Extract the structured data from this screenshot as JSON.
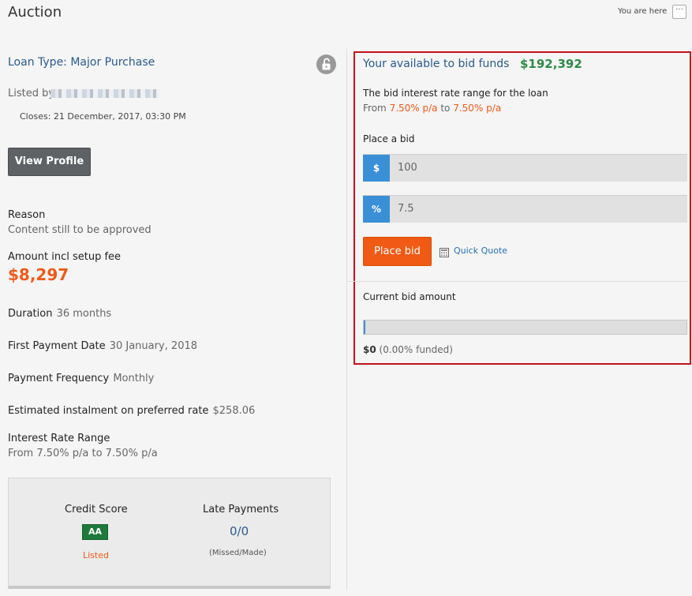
{
  "header": {
    "title": "Auction",
    "breadcrumb": "You are here",
    "more_label": "···"
  },
  "loan": {
    "type": "Loan Type: Major Purchase",
    "listed_by_label": "Listed by",
    "closes": "Closes: 21 December, 2017, 03:30 PM",
    "view_profile_label": "View Profile",
    "reason_label": "Reason",
    "reason_value": "Content still to be approved",
    "amount_label": "Amount incl setup fee",
    "amount_value": "$8,297",
    "duration_label": "Duration",
    "duration_value": "36 months",
    "first_payment_label": "First Payment Date",
    "first_payment_value": "30 January, 2018",
    "frequency_label": "Payment Frequency",
    "frequency_value": "Monthly",
    "instalment_label": "Estimated instalment on preferred rate",
    "instalment_value": "$258.06",
    "irr_label": "Interest Rate Range",
    "irr_value": "From 7.50% p/a to 7.50% p/a"
  },
  "credit": {
    "score_label": "Credit Score",
    "score_badge": "AA",
    "status": "Listed",
    "late_label": "Late Payments",
    "late_value": "0/0",
    "late_note": "(Missed/Made)"
  },
  "bid": {
    "funds_label": "Your available to bid funds",
    "funds_value": "$192,392",
    "range_title": "The bid interest rate range for the loan",
    "range_from": "From",
    "range_low": "7.50% p/a",
    "range_to": "to",
    "range_high": "7.50% p/a",
    "place_label": "Place a bid",
    "amount_addon": "$",
    "amount_value": "100",
    "rate_addon": "%",
    "rate_value": "7.5",
    "button_label": "Place bid",
    "quick_quote_label": "Quick Quote",
    "current_label": "Current bid amount",
    "funded_fraction": 0.0,
    "current_amount": "$0",
    "funded_pct": "(0.00% funded)"
  },
  "colors": {
    "accent_orange": "#f05a14",
    "accent_blue": "#3a8fd6",
    "highlight_border": "#c0121c",
    "credit_green": "#1e7a3c"
  }
}
